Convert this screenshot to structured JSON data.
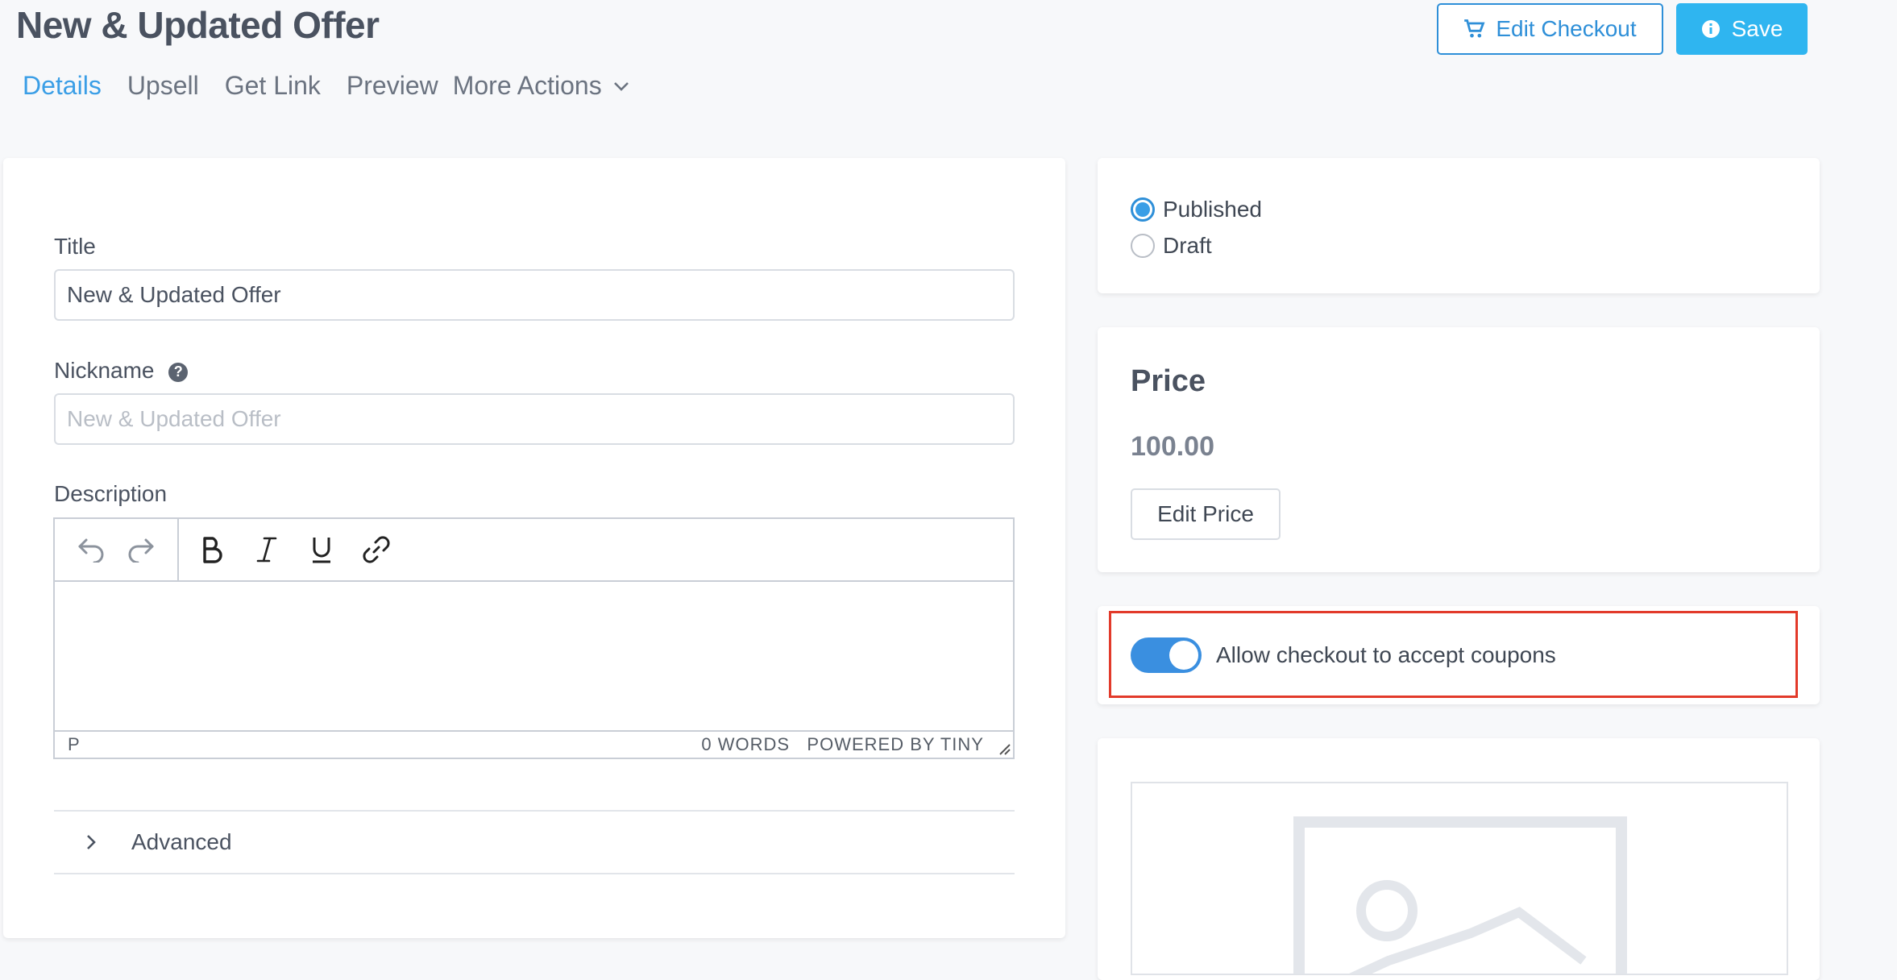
{
  "header": {
    "title": "New & Updated Offer",
    "tabs": [
      {
        "label": "Details",
        "active": true
      },
      {
        "label": "Upsell"
      },
      {
        "label": "Get Link"
      },
      {
        "label": "Preview"
      },
      {
        "label": "More Actions"
      }
    ],
    "edit_checkout_label": "Edit Checkout",
    "save_label": "Save"
  },
  "form": {
    "title_label": "Title",
    "title_value": "New & Updated Offer",
    "nickname_label": "Nickname",
    "nickname_placeholder": "New & Updated Offer",
    "description_label": "Description",
    "editor": {
      "path": "P",
      "word_count": "0 WORDS",
      "branding": "POWERED BY TINY"
    },
    "advanced_label": "Advanced"
  },
  "status": {
    "options": [
      "Published",
      "Draft"
    ],
    "selected": "Published"
  },
  "price": {
    "heading": "Price",
    "value": "100.00",
    "edit_label": "Edit Price"
  },
  "coupons": {
    "label": "Allow checkout to accept coupons",
    "enabled": true
  },
  "colors": {
    "accent": "#3a9ee6",
    "save_bg": "#2fb5f0",
    "highlight": "#e23a2a"
  }
}
